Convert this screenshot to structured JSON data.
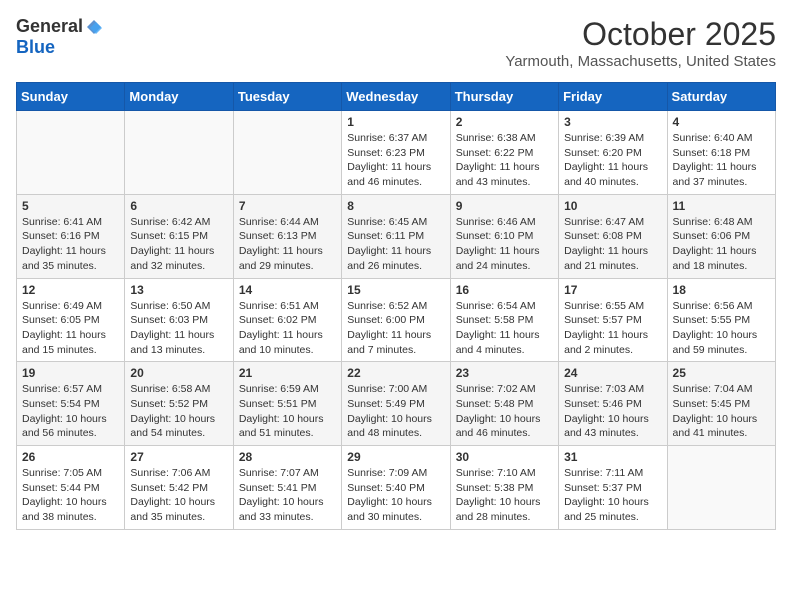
{
  "header": {
    "logo_general": "General",
    "logo_blue": "Blue",
    "month_title": "October 2025",
    "location": "Yarmouth, Massachusetts, United States"
  },
  "weekdays": [
    "Sunday",
    "Monday",
    "Tuesday",
    "Wednesday",
    "Thursday",
    "Friday",
    "Saturday"
  ],
  "weeks": [
    [
      {
        "day": "",
        "info": ""
      },
      {
        "day": "",
        "info": ""
      },
      {
        "day": "",
        "info": ""
      },
      {
        "day": "1",
        "info": "Sunrise: 6:37 AM\nSunset: 6:23 PM\nDaylight: 11 hours\nand 46 minutes."
      },
      {
        "day": "2",
        "info": "Sunrise: 6:38 AM\nSunset: 6:22 PM\nDaylight: 11 hours\nand 43 minutes."
      },
      {
        "day": "3",
        "info": "Sunrise: 6:39 AM\nSunset: 6:20 PM\nDaylight: 11 hours\nand 40 minutes."
      },
      {
        "day": "4",
        "info": "Sunrise: 6:40 AM\nSunset: 6:18 PM\nDaylight: 11 hours\nand 37 minutes."
      }
    ],
    [
      {
        "day": "5",
        "info": "Sunrise: 6:41 AM\nSunset: 6:16 PM\nDaylight: 11 hours\nand 35 minutes."
      },
      {
        "day": "6",
        "info": "Sunrise: 6:42 AM\nSunset: 6:15 PM\nDaylight: 11 hours\nand 32 minutes."
      },
      {
        "day": "7",
        "info": "Sunrise: 6:44 AM\nSunset: 6:13 PM\nDaylight: 11 hours\nand 29 minutes."
      },
      {
        "day": "8",
        "info": "Sunrise: 6:45 AM\nSunset: 6:11 PM\nDaylight: 11 hours\nand 26 minutes."
      },
      {
        "day": "9",
        "info": "Sunrise: 6:46 AM\nSunset: 6:10 PM\nDaylight: 11 hours\nand 24 minutes."
      },
      {
        "day": "10",
        "info": "Sunrise: 6:47 AM\nSunset: 6:08 PM\nDaylight: 11 hours\nand 21 minutes."
      },
      {
        "day": "11",
        "info": "Sunrise: 6:48 AM\nSunset: 6:06 PM\nDaylight: 11 hours\nand 18 minutes."
      }
    ],
    [
      {
        "day": "12",
        "info": "Sunrise: 6:49 AM\nSunset: 6:05 PM\nDaylight: 11 hours\nand 15 minutes."
      },
      {
        "day": "13",
        "info": "Sunrise: 6:50 AM\nSunset: 6:03 PM\nDaylight: 11 hours\nand 13 minutes."
      },
      {
        "day": "14",
        "info": "Sunrise: 6:51 AM\nSunset: 6:02 PM\nDaylight: 11 hours\nand 10 minutes."
      },
      {
        "day": "15",
        "info": "Sunrise: 6:52 AM\nSunset: 6:00 PM\nDaylight: 11 hours\nand 7 minutes."
      },
      {
        "day": "16",
        "info": "Sunrise: 6:54 AM\nSunset: 5:58 PM\nDaylight: 11 hours\nand 4 minutes."
      },
      {
        "day": "17",
        "info": "Sunrise: 6:55 AM\nSunset: 5:57 PM\nDaylight: 11 hours\nand 2 minutes."
      },
      {
        "day": "18",
        "info": "Sunrise: 6:56 AM\nSunset: 5:55 PM\nDaylight: 10 hours\nand 59 minutes."
      }
    ],
    [
      {
        "day": "19",
        "info": "Sunrise: 6:57 AM\nSunset: 5:54 PM\nDaylight: 10 hours\nand 56 minutes."
      },
      {
        "day": "20",
        "info": "Sunrise: 6:58 AM\nSunset: 5:52 PM\nDaylight: 10 hours\nand 54 minutes."
      },
      {
        "day": "21",
        "info": "Sunrise: 6:59 AM\nSunset: 5:51 PM\nDaylight: 10 hours\nand 51 minutes."
      },
      {
        "day": "22",
        "info": "Sunrise: 7:00 AM\nSunset: 5:49 PM\nDaylight: 10 hours\nand 48 minutes."
      },
      {
        "day": "23",
        "info": "Sunrise: 7:02 AM\nSunset: 5:48 PM\nDaylight: 10 hours\nand 46 minutes."
      },
      {
        "day": "24",
        "info": "Sunrise: 7:03 AM\nSunset: 5:46 PM\nDaylight: 10 hours\nand 43 minutes."
      },
      {
        "day": "25",
        "info": "Sunrise: 7:04 AM\nSunset: 5:45 PM\nDaylight: 10 hours\nand 41 minutes."
      }
    ],
    [
      {
        "day": "26",
        "info": "Sunrise: 7:05 AM\nSunset: 5:44 PM\nDaylight: 10 hours\nand 38 minutes."
      },
      {
        "day": "27",
        "info": "Sunrise: 7:06 AM\nSunset: 5:42 PM\nDaylight: 10 hours\nand 35 minutes."
      },
      {
        "day": "28",
        "info": "Sunrise: 7:07 AM\nSunset: 5:41 PM\nDaylight: 10 hours\nand 33 minutes."
      },
      {
        "day": "29",
        "info": "Sunrise: 7:09 AM\nSunset: 5:40 PM\nDaylight: 10 hours\nand 30 minutes."
      },
      {
        "day": "30",
        "info": "Sunrise: 7:10 AM\nSunset: 5:38 PM\nDaylight: 10 hours\nand 28 minutes."
      },
      {
        "day": "31",
        "info": "Sunrise: 7:11 AM\nSunset: 5:37 PM\nDaylight: 10 hours\nand 25 minutes."
      },
      {
        "day": "",
        "info": ""
      }
    ]
  ]
}
